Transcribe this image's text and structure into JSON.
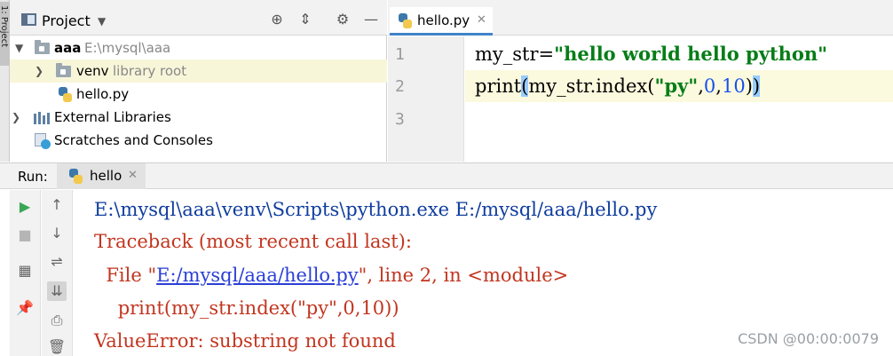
{
  "left_strip": {
    "tab_label": "1: Project"
  },
  "project": {
    "title": "Project",
    "tree": {
      "root_name": "aaa",
      "root_path": "E:\\mysql\\aaa",
      "venv_name": "venv",
      "venv_hint": "library root",
      "file_name": "hello.py",
      "external_libraries": "External Libraries",
      "scratches": "Scratches and Consoles"
    }
  },
  "editor": {
    "tab_label": "hello.py",
    "line_numbers": [
      "1",
      "2",
      "3"
    ],
    "line1": {
      "var": "my_str=",
      "string": "\"hello world hello python\""
    },
    "line2": {
      "call": "print",
      "open": "(",
      "mid": "my_str.index(",
      "string": "\"py\"",
      "comma1": ",",
      "n1": "0",
      "comma2": ",",
      "n2": "10",
      "close_inner": ")",
      "close_outer": ")"
    }
  },
  "run": {
    "label": "Run:",
    "tab_label": "hello",
    "console": {
      "line1": "E:\\mysql\\aaa\\venv\\Scripts\\python.exe E:/mysql/aaa/hello.py",
      "line2": "Traceback (most recent call last):",
      "line3_prefix": "  File \"",
      "line3_link": "E:/mysql/aaa/hello.py",
      "line3_suffix": "\", line 2, in <module>",
      "line4": "    print(my_str.index(\"py\",0,10))",
      "line5": "ValueError: substring not found"
    }
  },
  "watermark": "CSDN @00:00:0079",
  "colors": {
    "accent": "#4083c9",
    "string": "#067d17",
    "number": "#1750eb",
    "error": "#c2351f",
    "path": "#0f3d9e"
  }
}
